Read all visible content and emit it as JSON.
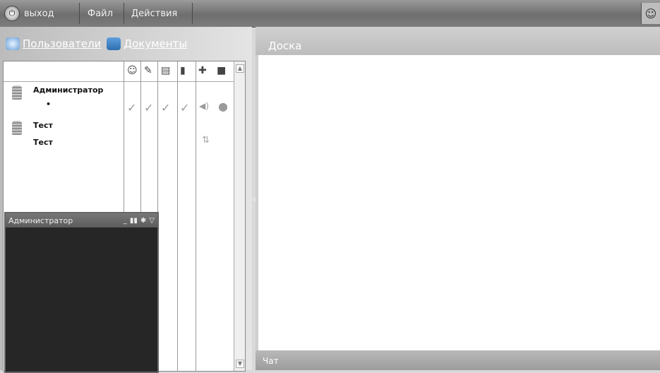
{
  "topbar": {
    "exit_label": "выход",
    "file_label": "Файл",
    "actions_label": "Действия"
  },
  "left": {
    "users_tab": "Пользователи",
    "documents_tab": "Документы",
    "users": [
      {
        "name": "Администратор",
        "sub": "•"
      },
      {
        "name": "Тест",
        "sub": "Тест"
      }
    ],
    "video_title": "Администратор"
  },
  "board": {
    "title": "Доска",
    "chat_label": "Чат"
  }
}
